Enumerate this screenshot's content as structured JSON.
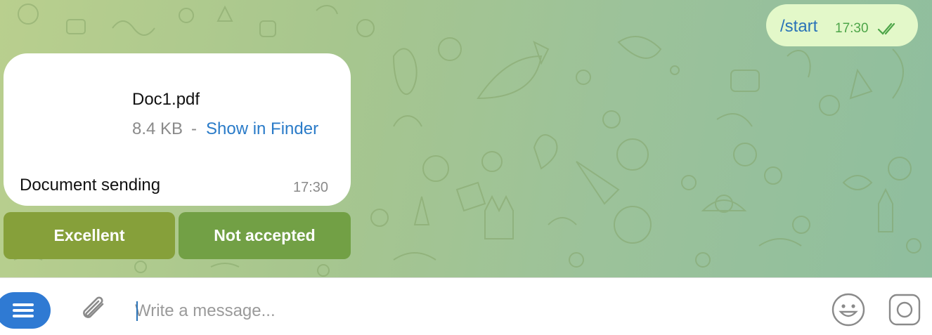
{
  "messages": {
    "outgoing": {
      "text": "/start",
      "time": "17:30",
      "status_icon": "double-check-icon"
    },
    "incoming_document": {
      "file_name": "Doc1.pdf",
      "file_size": "8.4 KB",
      "separator": "-",
      "show_in_finder": "Show in Finder",
      "caption": "Document sending",
      "time": "17:30"
    }
  },
  "inline_keyboard": {
    "buttons": [
      {
        "label": "Excellent",
        "color": "#86a03a"
      },
      {
        "label": "Not accepted",
        "color": "#72a045"
      }
    ]
  },
  "composer": {
    "menu_icon": "menu-icon",
    "attach_icon": "paperclip-icon",
    "placeholder": "Write a message...",
    "value": "",
    "emoji_icon": "emoji-icon",
    "camera_icon": "camera-icon"
  },
  "colors": {
    "accent": "#2f7ad3",
    "outgoing_bubble": "#e3f8c9",
    "link": "#2a7bc8",
    "read_check": "#4da548"
  }
}
